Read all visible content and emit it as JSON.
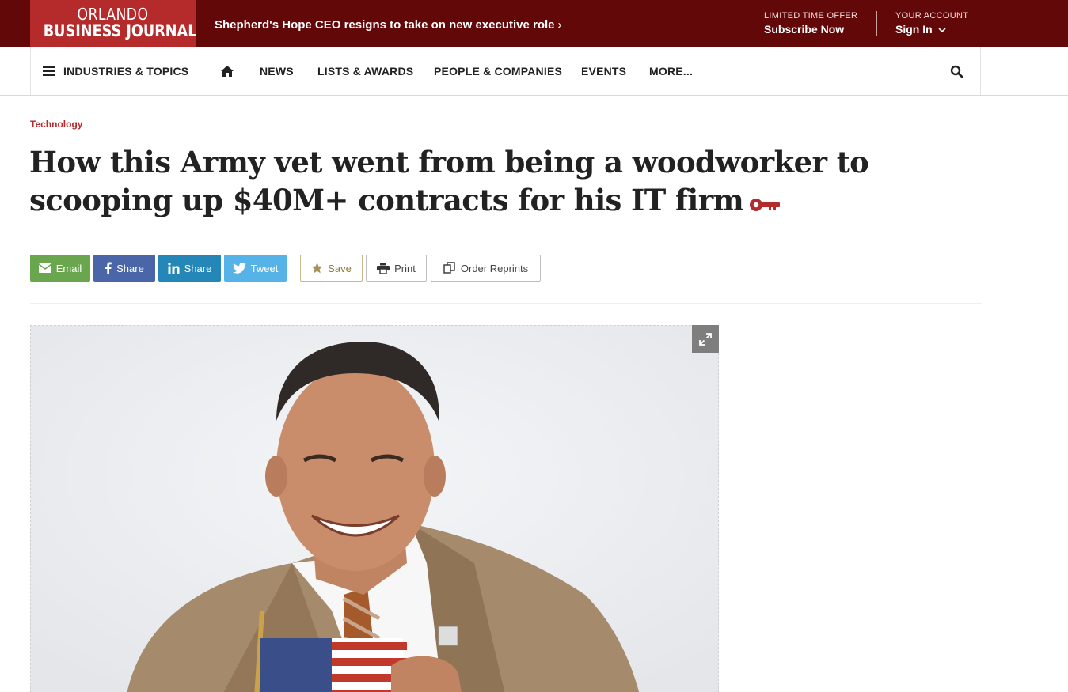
{
  "brand": {
    "line1": "ORLANDO",
    "line2": "BUSINESS JOURNAL",
    "color": "#b52b2b",
    "bar_color": "#620808"
  },
  "top_headline": {
    "text": "Shepherd's Hope CEO resigns to take on new executive role",
    "chevron_icon": "chevron-right-icon"
  },
  "offer": {
    "kicker": "LIMITED TIME OFFER",
    "cta": "Subscribe Now"
  },
  "account": {
    "kicker": "YOUR ACCOUNT",
    "cta": "Sign In",
    "chevron_icon": "chevron-down-icon"
  },
  "nav": {
    "topics_label": "INDUSTRIES & TOPICS",
    "home_icon": "home-icon",
    "items": [
      "NEWS",
      "LISTS & AWARDS",
      "PEOPLE & COMPANIES",
      "EVENTS",
      "MORE..."
    ],
    "search_icon": "search-icon"
  },
  "article": {
    "section": "Technology",
    "title": "How this Army vet went from being a woodworker to scooping up $40M+ contracts for his IT firm",
    "premium_icon": "key-icon"
  },
  "share": {
    "email": "Email",
    "facebook": "Share",
    "linkedin": "Share",
    "twitter": "Tweet"
  },
  "tools": {
    "save": "Save",
    "print": "Print",
    "reprints": "Order Reprints"
  },
  "photo": {
    "expand_icon": "expand-icon"
  }
}
